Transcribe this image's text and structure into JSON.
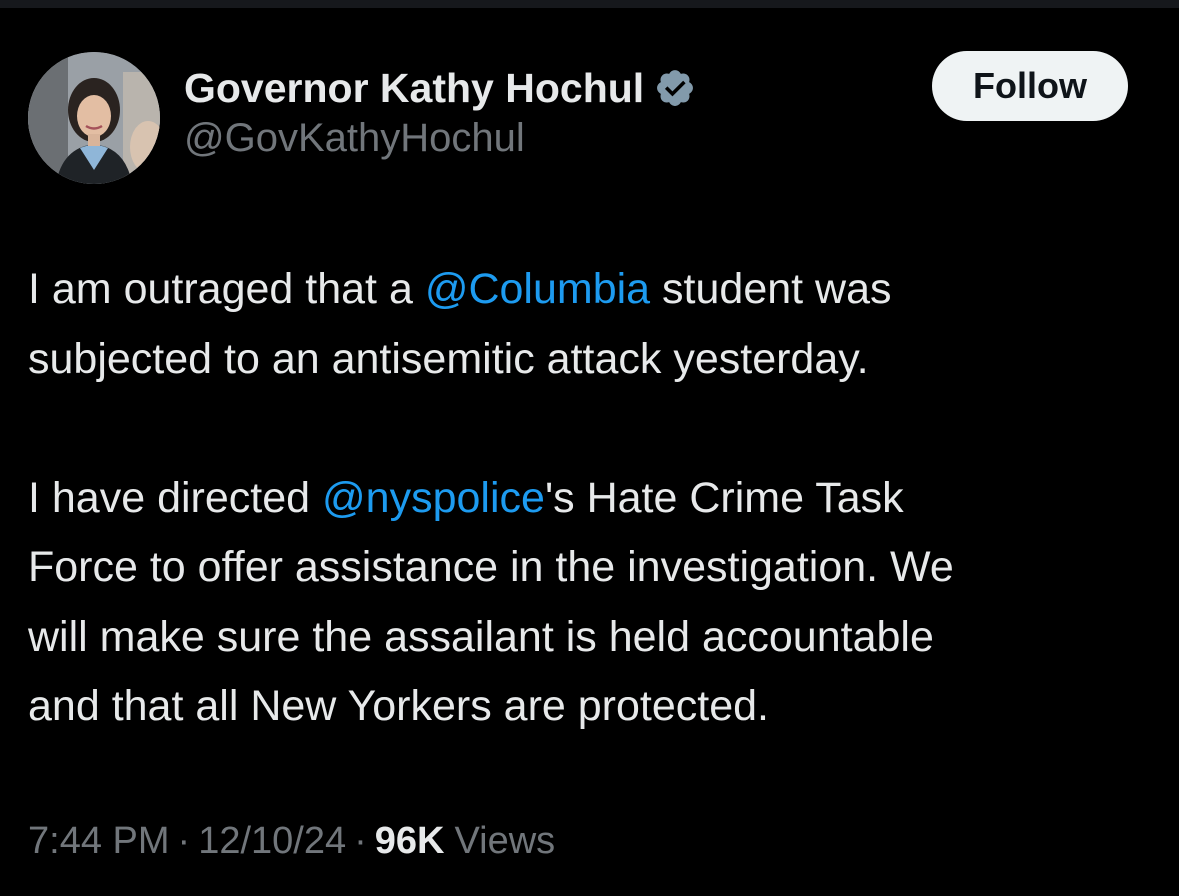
{
  "author": {
    "display_name": "Governor Kathy Hochul",
    "handle": "@GovKathyHochul",
    "verified_color": "#829aab"
  },
  "actions": {
    "follow_label": "Follow"
  },
  "tweet": {
    "p1": {
      "l1_a": "I am outraged that a ",
      "l1_mention": "@Columbia",
      "l1_b": " student was",
      "l2": "subjected to an antisemitic attack yesterday."
    },
    "p2": {
      "l1_a": "I have directed ",
      "l1_mention": "@nyspolice",
      "l1_b": "'s Hate Crime Task",
      "l2": "Force to offer assistance in the investigation. We",
      "l3": "will make sure the assailant is held accountable",
      "l4": "and that all New Yorkers are protected."
    }
  },
  "meta": {
    "time": "7:44 PM",
    "separator": "·",
    "date": "12/10/24",
    "views_count": "96K",
    "views_label": "Views"
  },
  "colors": {
    "background": "#000000",
    "text": "#e7e9ea",
    "secondary": "#71767b",
    "link": "#1d9bf0",
    "button_bg": "#eff3f4"
  }
}
